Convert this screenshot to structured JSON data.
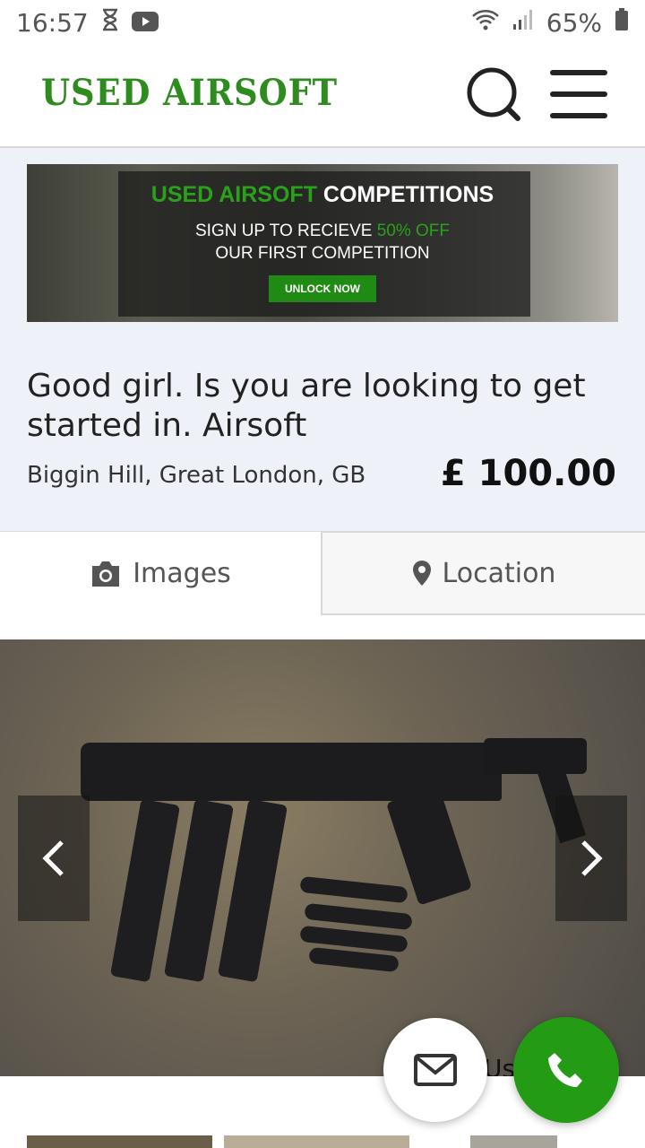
{
  "status_bar": {
    "time": "16:57",
    "battery": "65%"
  },
  "header": {
    "logo": "USED AIRSOFT",
    "search_icon": "search-icon",
    "menu_icon": "hamburger-menu-icon"
  },
  "banner": {
    "title_green": "USED AIRSOFT",
    "title_white": " COMPETITIONS",
    "line1_white": "SIGN UP TO RECIEVE ",
    "line1_green": "50% OFF",
    "line2": "OUR FIRST COMPETITION",
    "button": "UNLOCK NOW"
  },
  "listing": {
    "title": "Good girl. Is you are looking to get started in. Airsoft",
    "location": "Biggin Hill, Great London, GB",
    "price": "£ 100.00"
  },
  "tabs": [
    {
      "label": "Images",
      "icon": "camera-icon"
    },
    {
      "label": "Location",
      "icon": "map-pin-icon"
    }
  ],
  "gallery": {
    "watermark": "Us                t"
  },
  "colors": {
    "brand_green": "#2e8b1e",
    "call_green": "#239b14",
    "background_light": "#eef2f8"
  }
}
